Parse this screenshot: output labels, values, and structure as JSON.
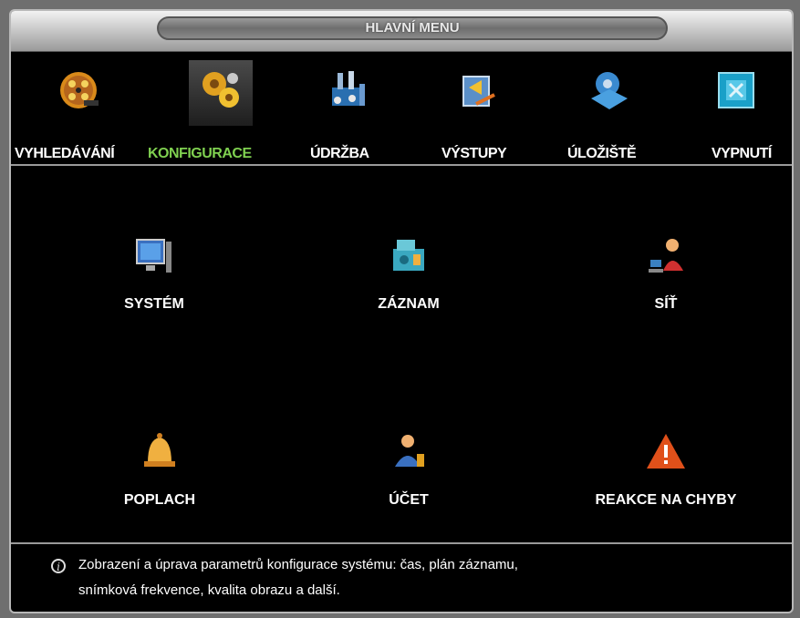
{
  "title": "HLAVNÍ MENU",
  "top_menu": [
    {
      "label": "VYHLEDÁVÁNÍ",
      "icon": "film-reel-icon"
    },
    {
      "label": "KONFIGURACE",
      "icon": "gears-icon",
      "active": true
    },
    {
      "label": "ÚDRŽBA",
      "icon": "tools-icon"
    },
    {
      "label": "VÝSTUPY",
      "icon": "export-icon"
    },
    {
      "label": "ÚLOŽIŠTĚ",
      "icon": "storage-icon"
    },
    {
      "label": "VYPNUTÍ",
      "icon": "shutdown-icon"
    }
  ],
  "grid": [
    {
      "label": "SYSTÉM",
      "icon": "monitor-icon"
    },
    {
      "label": "ZÁZNAM",
      "icon": "recorder-icon"
    },
    {
      "label": "SÍŤ",
      "icon": "network-user-icon"
    },
    {
      "label": "POPLACH",
      "icon": "bell-icon"
    },
    {
      "label": "ÚČET",
      "icon": "account-icon"
    },
    {
      "label": "REAKCE NA CHYBY",
      "icon": "warning-icon"
    }
  ],
  "info": {
    "line1": "Zobrazení a úprava parametrů konfigurace systému: čas, plán záznamu,",
    "line2": "snímková frekvence, kvalita obrazu a další."
  },
  "colors": {
    "active": "#7fd050",
    "text": "#ffffff",
    "background": "#000000"
  }
}
